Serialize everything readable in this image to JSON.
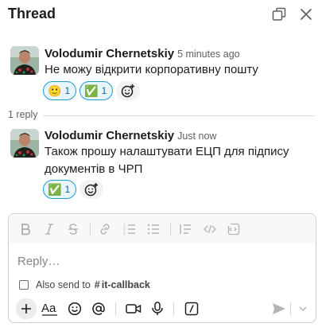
{
  "header": {
    "title": "Thread"
  },
  "parent_message": {
    "author": "Volodumir Chernetskiy",
    "timestamp": "5 minutes ago",
    "text": "Не можу відкрити корпоративну пошту",
    "reactions": [
      {
        "icon": "slightly-smiling-face-icon",
        "emoji": "🙂",
        "count": "1"
      },
      {
        "icon": "white-check-mark-icon",
        "emoji": "✅",
        "count": "1"
      }
    ]
  },
  "replies": {
    "count_label": "1 reply"
  },
  "reply_message": {
    "author": "Volodumir Chernetskiy",
    "timestamp": "Just now",
    "text": "Також прошу налаштувати ЕЦП для підпису документів в ЧРП",
    "reactions": [
      {
        "icon": "white-check-mark-icon",
        "emoji": "✅",
        "count": "1"
      }
    ]
  },
  "composer": {
    "placeholder": "Reply…",
    "also_send_label": "Also send to",
    "channel_hash": "#",
    "channel_name": "it-callback"
  },
  "colors": {
    "accent_blue": "#1264a3",
    "reaction_border": "#1d9bd1",
    "reaction_bg": "#e8f5fa"
  }
}
